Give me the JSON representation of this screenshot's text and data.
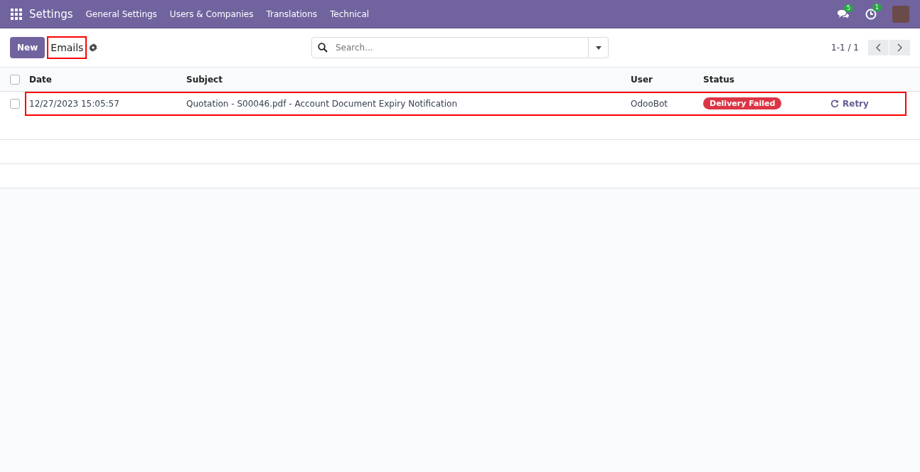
{
  "navbar": {
    "app_title": "Settings",
    "menu": [
      "General Settings",
      "Users & Companies",
      "Translations",
      "Technical"
    ],
    "messages_badge": "5",
    "activities_badge": "1"
  },
  "control_panel": {
    "new_button": "New",
    "title": "Emails",
    "title_highlighted": true,
    "search": {
      "placeholder": "Search..."
    },
    "pager": "1-1 / 1"
  },
  "table": {
    "columns": [
      "Date",
      "Subject",
      "User",
      "Status"
    ],
    "header_checked": false,
    "rows": [
      {
        "checked": false,
        "highlighted": true,
        "date": "12/27/2023 15:05:57",
        "subject": "Quotation - S00046.pdf - Account Document Expiry Notification",
        "user": "OdooBot",
        "status": "Delivery Failed",
        "color": "#dc3545",
        "action": "Retry"
      }
    ]
  }
}
